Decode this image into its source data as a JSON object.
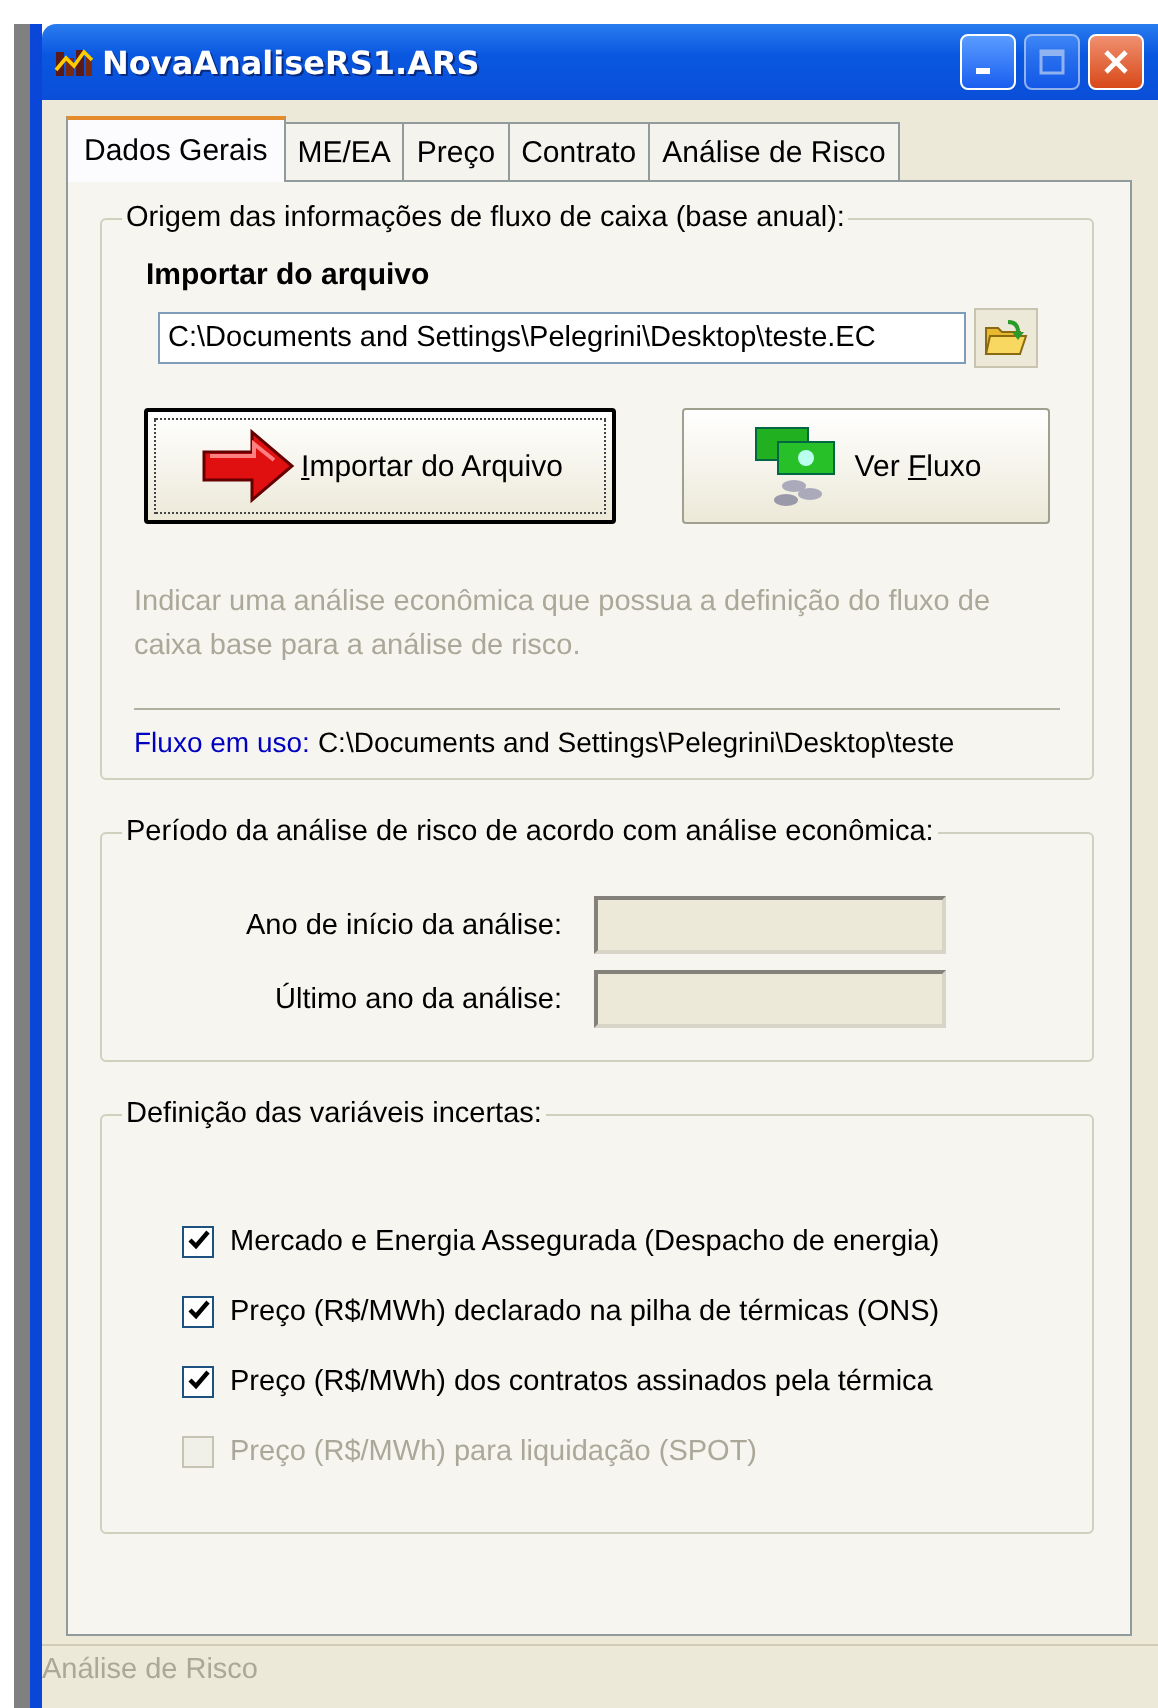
{
  "window": {
    "title": "NovaAnaliseRS1.ARS",
    "controls": [
      {
        "kind": "minimize",
        "disabled": false
      },
      {
        "kind": "maximize",
        "disabled": true
      },
      {
        "kind": "close",
        "disabled": false
      }
    ]
  },
  "tabs": [
    {
      "label": "Dados Gerais",
      "selected": true
    },
    {
      "label": "ME/EA",
      "selected": false
    },
    {
      "label": "Preço",
      "selected": false
    },
    {
      "label": "Contrato",
      "selected": false
    },
    {
      "label": "Análise de Risco",
      "selected": false
    }
  ],
  "source_group": {
    "legend": "Origem das informações de fluxo de caixa (base anual):",
    "heading": "Importar do arquivo",
    "file_field": {
      "value": "C:\\Documents and Settings\\Pelegrini\\Desktop\\teste.EC"
    },
    "buttons": [
      {
        "kind": "import",
        "hotkey": "I",
        "suffix": "mportar do Arquivo",
        "focused": true
      },
      {
        "kind": "view",
        "prefix": "Ver ",
        "hotkey": "F",
        "suffix": "luxo",
        "focused": false
      }
    ],
    "hint": "Indicar uma análise econômica que possua a definição do fluxo de caixa base para a análise de risco.",
    "flow_label": "Fluxo em uso:",
    "flow_path": "C:\\Documents and Settings\\Pelegrini\\Desktop\\teste"
  },
  "period_group": {
    "legend": "Período da análise de risco de acordo com análise econômica:",
    "fields": [
      {
        "label": "Ano de início da análise:",
        "disabled": true
      },
      {
        "label": "Último ano da análise:",
        "disabled": true
      }
    ]
  },
  "variables_group": {
    "legend": "Definição das variáveis incertas:",
    "options": [
      {
        "label": "Mercado e Energia Assegurada (Despacho de energia)",
        "checked": true,
        "disabled": false
      },
      {
        "label": "Preço (R$/MWh) declarado na pilha de térmicas (ONS)",
        "checked": true,
        "disabled": false
      },
      {
        "label": "Preço (R$/MWh) dos contratos assinados pela térmica",
        "checked": true,
        "disabled": false
      },
      {
        "label": "Preço (R$/MWh) para liquidação (SPOT)",
        "checked": false,
        "disabled": true
      }
    ]
  },
  "status_bar": {
    "text": "Análise de Risco"
  }
}
